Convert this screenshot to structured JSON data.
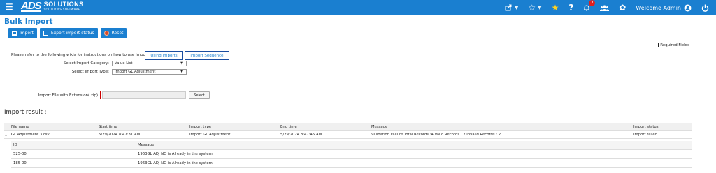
{
  "topbar": {
    "logo_mark": "ADS",
    "logo_name": "SOLUTIONS",
    "logo_tag": "SOLUTIONS SOFTWARE",
    "welcome": "Welcome Admin",
    "notification_count": "7",
    "colors": {
      "bar": "#1a7fd0",
      "star_active": "#ffd21f",
      "badge": "#e02020"
    }
  },
  "page": {
    "title": "Bulk Import",
    "buttons": {
      "import": "Import",
      "export_status": "Export import status",
      "reset": "Reset"
    },
    "required_fields": "Required Fields",
    "wiki_text": "Please refer to the following wikis for instructions on how to use Imports:",
    "wiki_links": {
      "using": "Using Imports",
      "sequence": "Import Sequence"
    },
    "category_label": "Select Import Category:",
    "category_value": "Value List",
    "type_label": "Select Import Type:",
    "type_value": "Import GL Adjustment",
    "file_label": "Import File with Extension(.zip)",
    "select_button": "Select"
  },
  "result": {
    "heading": "Import result :",
    "columns": [
      "File name",
      "Start time",
      "Import type",
      "End time",
      "Message",
      "Import status"
    ],
    "row": {
      "file_name": "GL Adjustment 3.csv",
      "start_time": "5/29/2024 8:47:31 AM",
      "import_type": "Import GL Adjustment",
      "end_time": "5/29/2024 8:47:45 AM",
      "message": "Validation Failure Total Records :4 Valid Records : 2 Invalid Records : 2",
      "status": "Import failed."
    },
    "sub_columns": [
      "ID",
      "Message"
    ],
    "sub_rows": [
      {
        "id": "525-00",
        "message": "1963GL ADJ NO is Already in the system"
      },
      {
        "id": "185-00",
        "message": "1963GL ADJ NO is Already in the system"
      }
    ]
  }
}
